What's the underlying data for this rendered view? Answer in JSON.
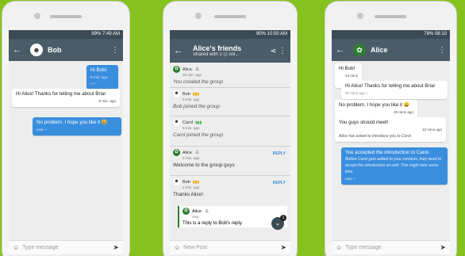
{
  "phones": {
    "bob": {
      "status_time": "99% 7:49 AM",
      "title": "Bob",
      "messages": [
        {
          "text": "Hi Bob!",
          "meta": "9 min. ago ✓✓",
          "dir": "out"
        },
        {
          "text": "Hi Alice! Thanks for telling me about Briar",
          "meta": "8 min. ago",
          "dir": "in"
        },
        {
          "text": "No problem. I hope you like it 😃",
          "meta": "now ✓",
          "dir": "out"
        }
      ],
      "composer_placeholder": "Type message"
    },
    "group": {
      "status_time": "90% 10:00 AM",
      "title": "Alice's friends",
      "subtitle": "Shared with 2 (2 onl...",
      "posts": [
        {
          "author": "Alice",
          "time": "15 min. ago",
          "body": "You created the group",
          "italic": true
        },
        {
          "author": "Bob",
          "time": "9 min. ago",
          "body": "Bob joined the group",
          "italic": true
        },
        {
          "author": "Carol",
          "time": "5 min. ago",
          "body": "Carol joined the group",
          "italic": true
        },
        {
          "author": "Alice",
          "time": "3 min. ago",
          "body": "Welcome to the group guys",
          "reply": "REPLY"
        },
        {
          "author": "Bob",
          "time": "2 min. ago",
          "body": "Thanks Alice!",
          "reply": "REPLY"
        }
      ],
      "quote": {
        "author": "Alice",
        "time": "now",
        "body": "This is a reply to Bob's reply"
      },
      "fab_badge": "1",
      "composer_placeholder": "New Post"
    },
    "alice": {
      "status_time": "78% 08:10",
      "title": "Alice",
      "messages": [
        {
          "text": "Hi Bob!",
          "meta": "33 mins ago",
          "dir": "in"
        },
        {
          "text": "Hi Alice! Thanks for telling me about Briar",
          "meta": "30 mins ago ✓",
          "dir": "out"
        },
        {
          "text": "No problem. I hope you like it 😀",
          "meta": "29 mins ago",
          "dir": "in"
        },
        {
          "text": "You guys should meet!",
          "meta": "12 mins ago",
          "notice": "Alice has asked to introduce you to Carol",
          "dir": "in"
        },
        {
          "text": "You accepted the introduction to Carol.",
          "notice": "Before Carol gets added to your contacts, they need to accept the introduction as well. This might take some time.",
          "meta": "now ✓",
          "dir": "out"
        }
      ],
      "composer_placeholder": "Type message"
    }
  }
}
